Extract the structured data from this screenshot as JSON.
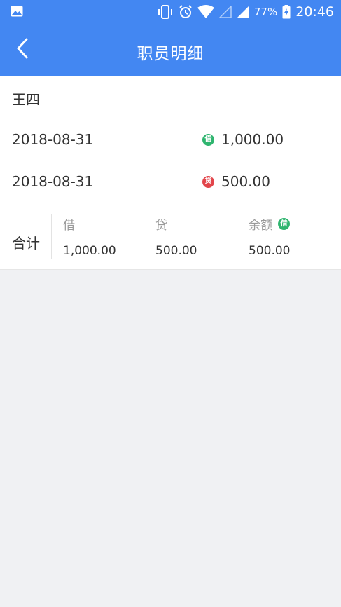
{
  "status_bar": {
    "battery_percent": "77%",
    "time": "20:46",
    "icons": [
      "image-icon",
      "vibrate-icon",
      "alarm-icon",
      "wifi-icon",
      "signal-empty-icon",
      "signal-icon",
      "battery-charging-icon"
    ]
  },
  "header": {
    "title": "职员明细",
    "back_icon": "chevron-left-icon",
    "background": "#4387f2"
  },
  "employee": {
    "name": "王四"
  },
  "entries": [
    {
      "date": "2018-08-31",
      "type_badge": "借",
      "type_color": "#2fb56f",
      "amount": "1,000.00"
    },
    {
      "date": "2018-08-31",
      "type_badge": "贷",
      "type_color": "#e2454b",
      "amount": "500.00"
    }
  ],
  "totals": {
    "label": "合计",
    "debit_label": "借",
    "debit_value": "1,000.00",
    "credit_label": "贷",
    "credit_value": "500.00",
    "balance_label": "余额",
    "balance_badge": "借",
    "balance_value": "500.00"
  }
}
